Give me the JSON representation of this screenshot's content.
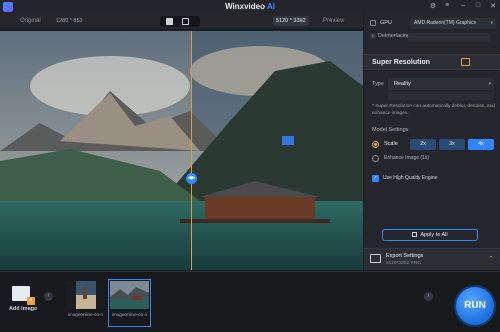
{
  "app": {
    "title_main": "Winxvideo",
    "title_ai": "AI"
  },
  "compare": {
    "original_label": "Original",
    "original_res": "1280 * 853",
    "output_res": "5120 * 3392",
    "preview_label": "Preview"
  },
  "panel": {
    "gpu_label": "GPU",
    "gpu_value": "AMD Radeon(TM) Graphics",
    "deinterlacing_label": "Deinterlacing",
    "section_title": "Super Resolution",
    "type_label": "Type",
    "type_value": "Reality",
    "note": "* Super Resolution can automatically deblur, denoise, and enhance images.",
    "model_settings_label": "Model Settings",
    "scale_label": "Scale",
    "scale_options": [
      "2x",
      "3x",
      "4x"
    ],
    "scale_selected": "4x",
    "enhance_label": "Enhance Image (1x)",
    "hq_label": "Use High Quality Engine",
    "apply_label": "Apply to All"
  },
  "export": {
    "title": "Export Settings",
    "value": "5120*3392  PNG"
  },
  "bottom": {
    "add_label": "Add Image",
    "thumbs": [
      {
        "caption": "imageonline-co-n"
      },
      {
        "caption": "imageonline-co-n"
      }
    ],
    "run_label": "RUN"
  },
  "colors": {
    "accent_blue": "#2f84ff",
    "accent_orange": "#e8a03b",
    "background": "#1f2126"
  }
}
